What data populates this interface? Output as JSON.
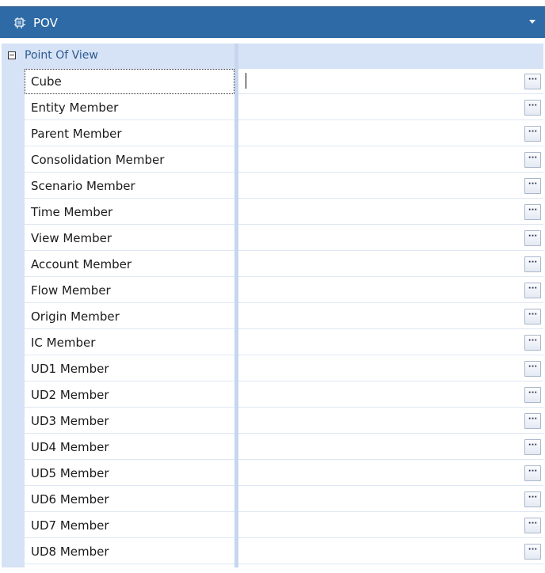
{
  "panel": {
    "title": "POV",
    "icon": "pov-icon"
  },
  "category": {
    "label": "Point Of View",
    "expanded": true
  },
  "properties": [
    {
      "name": "Cube",
      "value": "",
      "button": "···"
    },
    {
      "name": "Entity Member",
      "value": "",
      "button": "···"
    },
    {
      "name": "Parent Member",
      "value": "",
      "button": "···"
    },
    {
      "name": "Consolidation Member",
      "value": "",
      "button": "···"
    },
    {
      "name": "Scenario Member",
      "value": "",
      "button": "···"
    },
    {
      "name": "Time Member",
      "value": "",
      "button": "···"
    },
    {
      "name": "View Member",
      "value": "",
      "button": "···"
    },
    {
      "name": "Account Member",
      "value": "",
      "button": "···"
    },
    {
      "name": "Flow Member",
      "value": "",
      "button": "···"
    },
    {
      "name": "Origin Member",
      "value": "",
      "button": "···"
    },
    {
      "name": "IC Member",
      "value": "",
      "button": "···"
    },
    {
      "name": "UD1 Member",
      "value": "",
      "button": "···"
    },
    {
      "name": "UD2 Member",
      "value": "",
      "button": "···"
    },
    {
      "name": "UD3 Member",
      "value": "",
      "button": "···"
    },
    {
      "name": "UD4 Member",
      "value": "",
      "button": "···"
    },
    {
      "name": "UD5 Member",
      "value": "",
      "button": "···"
    },
    {
      "name": "UD6 Member",
      "value": "",
      "button": "···"
    },
    {
      "name": "UD7 Member",
      "value": "",
      "button": "···"
    },
    {
      "name": "UD8 Member",
      "value": "",
      "button": "···"
    }
  ],
  "colors": {
    "header": "#2d6aa6",
    "category_band": "#d6e2f5",
    "splitter": "#c6d6ee"
  }
}
